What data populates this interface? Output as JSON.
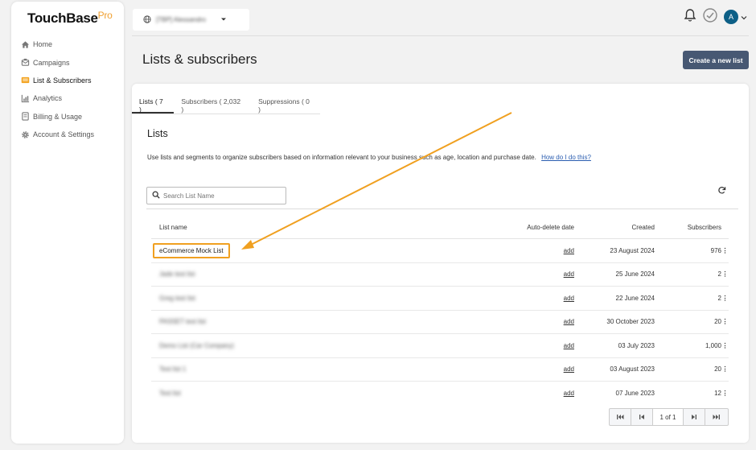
{
  "app": {
    "brand": "TouchBase",
    "brand_suffix": "Pro"
  },
  "sidebar": {
    "items": [
      {
        "label": "Home",
        "icon": "home-icon"
      },
      {
        "label": "Campaigns",
        "icon": "campaigns-icon"
      },
      {
        "label": "List & Subscribers",
        "icon": "lists-icon",
        "active": true
      },
      {
        "label": "Analytics",
        "icon": "analytics-icon"
      },
      {
        "label": "Billing & Usage",
        "icon": "billing-icon"
      },
      {
        "label": "Account & Settings",
        "icon": "gear-icon"
      }
    ]
  },
  "topbar": {
    "account_select": "[TBP] Alessandro"
  },
  "page": {
    "title": "Lists & subscribers",
    "create_button": "Create a new list"
  },
  "tabs": [
    "Lists ( 7 )",
    "Subscribers ( 2,032 )",
    "Suppressions ( 0 )"
  ],
  "section": {
    "title": "Lists",
    "description": "Use lists and segments to organize subscribers based on information relevant to your business such as age, location and purchase date.",
    "help_link": "How do I do this?"
  },
  "search": {
    "placeholder": "Search List Name"
  },
  "table": {
    "headers": {
      "name": "List name",
      "auto": "Auto-delete date",
      "created": "Created",
      "subs": "Subscribers"
    },
    "rows": [
      {
        "name": "eCommerce Mock List",
        "auto": "add",
        "created": "23 August 2024",
        "subs": "976"
      },
      {
        "name": "Jade test list",
        "auto": "add",
        "created": "25 June 2024",
        "subs": "2"
      },
      {
        "name": "Greg test list",
        "auto": "add",
        "created": "22 June 2024",
        "subs": "2"
      },
      {
        "name": "PASSET test list",
        "auto": "add",
        "created": "30 October 2023",
        "subs": "20"
      },
      {
        "name": "Demo List (Car Company)",
        "auto": "add",
        "created": "03 July 2023",
        "subs": "1,000"
      },
      {
        "name": "Test list 1",
        "auto": "add",
        "created": "03 August 2023",
        "subs": "20"
      },
      {
        "name": "Test list",
        "auto": "add",
        "created": "07 June 2023",
        "subs": "12"
      }
    ]
  },
  "pager": {
    "info": "1 of 1"
  },
  "colors": {
    "accent": "#475873",
    "highlight": "#f0a020",
    "avatar": "#0d5f86"
  },
  "user": {
    "initial": "A"
  }
}
